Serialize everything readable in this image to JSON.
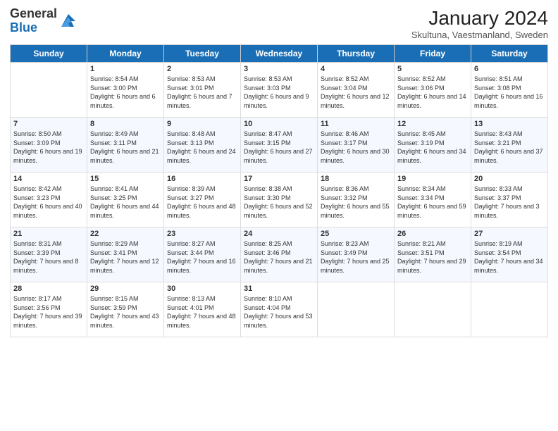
{
  "header": {
    "logo_general": "General",
    "logo_blue": "Blue",
    "title": "January 2024",
    "subtitle": "Skultuna, Vaestmanland, Sweden"
  },
  "weekdays": [
    "Sunday",
    "Monday",
    "Tuesday",
    "Wednesday",
    "Thursday",
    "Friday",
    "Saturday"
  ],
  "weeks": [
    [
      {
        "day": "",
        "sunrise": "",
        "sunset": "",
        "daylight": ""
      },
      {
        "day": "1",
        "sunrise": "Sunrise: 8:54 AM",
        "sunset": "Sunset: 3:00 PM",
        "daylight": "Daylight: 6 hours and 6 minutes."
      },
      {
        "day": "2",
        "sunrise": "Sunrise: 8:53 AM",
        "sunset": "Sunset: 3:01 PM",
        "daylight": "Daylight: 6 hours and 7 minutes."
      },
      {
        "day": "3",
        "sunrise": "Sunrise: 8:53 AM",
        "sunset": "Sunset: 3:03 PM",
        "daylight": "Daylight: 6 hours and 9 minutes."
      },
      {
        "day": "4",
        "sunrise": "Sunrise: 8:52 AM",
        "sunset": "Sunset: 3:04 PM",
        "daylight": "Daylight: 6 hours and 12 minutes."
      },
      {
        "day": "5",
        "sunrise": "Sunrise: 8:52 AM",
        "sunset": "Sunset: 3:06 PM",
        "daylight": "Daylight: 6 hours and 14 minutes."
      },
      {
        "day": "6",
        "sunrise": "Sunrise: 8:51 AM",
        "sunset": "Sunset: 3:08 PM",
        "daylight": "Daylight: 6 hours and 16 minutes."
      }
    ],
    [
      {
        "day": "7",
        "sunrise": "Sunrise: 8:50 AM",
        "sunset": "Sunset: 3:09 PM",
        "daylight": "Daylight: 6 hours and 19 minutes."
      },
      {
        "day": "8",
        "sunrise": "Sunrise: 8:49 AM",
        "sunset": "Sunset: 3:11 PM",
        "daylight": "Daylight: 6 hours and 21 minutes."
      },
      {
        "day": "9",
        "sunrise": "Sunrise: 8:48 AM",
        "sunset": "Sunset: 3:13 PM",
        "daylight": "Daylight: 6 hours and 24 minutes."
      },
      {
        "day": "10",
        "sunrise": "Sunrise: 8:47 AM",
        "sunset": "Sunset: 3:15 PM",
        "daylight": "Daylight: 6 hours and 27 minutes."
      },
      {
        "day": "11",
        "sunrise": "Sunrise: 8:46 AM",
        "sunset": "Sunset: 3:17 PM",
        "daylight": "Daylight: 6 hours and 30 minutes."
      },
      {
        "day": "12",
        "sunrise": "Sunrise: 8:45 AM",
        "sunset": "Sunset: 3:19 PM",
        "daylight": "Daylight: 6 hours and 34 minutes."
      },
      {
        "day": "13",
        "sunrise": "Sunrise: 8:43 AM",
        "sunset": "Sunset: 3:21 PM",
        "daylight": "Daylight: 6 hours and 37 minutes."
      }
    ],
    [
      {
        "day": "14",
        "sunrise": "Sunrise: 8:42 AM",
        "sunset": "Sunset: 3:23 PM",
        "daylight": "Daylight: 6 hours and 40 minutes."
      },
      {
        "day": "15",
        "sunrise": "Sunrise: 8:41 AM",
        "sunset": "Sunset: 3:25 PM",
        "daylight": "Daylight: 6 hours and 44 minutes."
      },
      {
        "day": "16",
        "sunrise": "Sunrise: 8:39 AM",
        "sunset": "Sunset: 3:27 PM",
        "daylight": "Daylight: 6 hours and 48 minutes."
      },
      {
        "day": "17",
        "sunrise": "Sunrise: 8:38 AM",
        "sunset": "Sunset: 3:30 PM",
        "daylight": "Daylight: 6 hours and 52 minutes."
      },
      {
        "day": "18",
        "sunrise": "Sunrise: 8:36 AM",
        "sunset": "Sunset: 3:32 PM",
        "daylight": "Daylight: 6 hours and 55 minutes."
      },
      {
        "day": "19",
        "sunrise": "Sunrise: 8:34 AM",
        "sunset": "Sunset: 3:34 PM",
        "daylight": "Daylight: 6 hours and 59 minutes."
      },
      {
        "day": "20",
        "sunrise": "Sunrise: 8:33 AM",
        "sunset": "Sunset: 3:37 PM",
        "daylight": "Daylight: 7 hours and 3 minutes."
      }
    ],
    [
      {
        "day": "21",
        "sunrise": "Sunrise: 8:31 AM",
        "sunset": "Sunset: 3:39 PM",
        "daylight": "Daylight: 7 hours and 8 minutes."
      },
      {
        "day": "22",
        "sunrise": "Sunrise: 8:29 AM",
        "sunset": "Sunset: 3:41 PM",
        "daylight": "Daylight: 7 hours and 12 minutes."
      },
      {
        "day": "23",
        "sunrise": "Sunrise: 8:27 AM",
        "sunset": "Sunset: 3:44 PM",
        "daylight": "Daylight: 7 hours and 16 minutes."
      },
      {
        "day": "24",
        "sunrise": "Sunrise: 8:25 AM",
        "sunset": "Sunset: 3:46 PM",
        "daylight": "Daylight: 7 hours and 21 minutes."
      },
      {
        "day": "25",
        "sunrise": "Sunrise: 8:23 AM",
        "sunset": "Sunset: 3:49 PM",
        "daylight": "Daylight: 7 hours and 25 minutes."
      },
      {
        "day": "26",
        "sunrise": "Sunrise: 8:21 AM",
        "sunset": "Sunset: 3:51 PM",
        "daylight": "Daylight: 7 hours and 29 minutes."
      },
      {
        "day": "27",
        "sunrise": "Sunrise: 8:19 AM",
        "sunset": "Sunset: 3:54 PM",
        "daylight": "Daylight: 7 hours and 34 minutes."
      }
    ],
    [
      {
        "day": "28",
        "sunrise": "Sunrise: 8:17 AM",
        "sunset": "Sunset: 3:56 PM",
        "daylight": "Daylight: 7 hours and 39 minutes."
      },
      {
        "day": "29",
        "sunrise": "Sunrise: 8:15 AM",
        "sunset": "Sunset: 3:59 PM",
        "daylight": "Daylight: 7 hours and 43 minutes."
      },
      {
        "day": "30",
        "sunrise": "Sunrise: 8:13 AM",
        "sunset": "Sunset: 4:01 PM",
        "daylight": "Daylight: 7 hours and 48 minutes."
      },
      {
        "day": "31",
        "sunrise": "Sunrise: 8:10 AM",
        "sunset": "Sunset: 4:04 PM",
        "daylight": "Daylight: 7 hours and 53 minutes."
      },
      {
        "day": "",
        "sunrise": "",
        "sunset": "",
        "daylight": ""
      },
      {
        "day": "",
        "sunrise": "",
        "sunset": "",
        "daylight": ""
      },
      {
        "day": "",
        "sunrise": "",
        "sunset": "",
        "daylight": ""
      }
    ]
  ]
}
